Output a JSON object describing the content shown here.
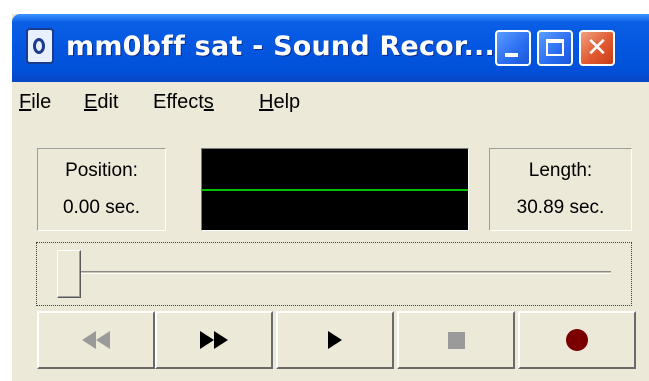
{
  "window": {
    "title": "mm0bff sat - Sound Recor..."
  },
  "menu": [
    {
      "underline": "F",
      "rest": "ile"
    },
    {
      "underline": "E",
      "rest": "dit"
    },
    {
      "pre": "Effect",
      "underline": "s"
    },
    {
      "underline": "H",
      "rest": "elp"
    }
  ],
  "position": {
    "label": "Position:",
    "value": "0.00 sec."
  },
  "length": {
    "label": "Length:",
    "value": "30.89 sec."
  },
  "colors": {
    "waveform_bg": "#000000",
    "waveform_line": "#00c000",
    "record": "#7a0000"
  },
  "slider": {
    "position_fraction": 0.0
  },
  "transport": [
    {
      "name": "seek-to-start",
      "icon": "rewind-icon",
      "enabled": false
    },
    {
      "name": "seek-to-end",
      "icon": "fast-forward-icon",
      "enabled": true
    },
    {
      "name": "play",
      "icon": "play-icon",
      "enabled": true
    },
    {
      "name": "stop",
      "icon": "stop-icon",
      "enabled": false
    },
    {
      "name": "record",
      "icon": "record-icon",
      "enabled": true
    }
  ]
}
